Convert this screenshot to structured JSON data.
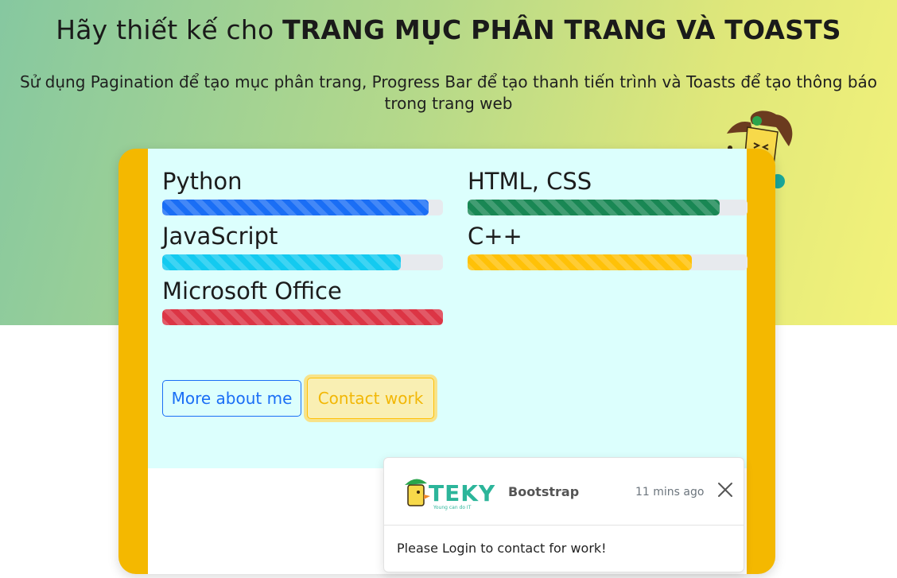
{
  "header": {
    "headline_prefix": "Hãy thiết kế cho ",
    "headline_bold": "TRANG MỤC PHÂN TRANG VÀ TOASTS",
    "subtitle": "Sử dụng Pagination để tạo mục phân trang, Progress Bar để tạo thanh tiến trình  và Toasts để tạo thông báo trong trang web"
  },
  "skills": [
    {
      "label": "Python",
      "progress": 0.95,
      "color": "#1a6ef5"
    },
    {
      "label": "HTML, CSS",
      "progress": 0.9,
      "color": "#198754"
    },
    {
      "label": "JavaScript",
      "progress": 0.85,
      "color": "#13caf0"
    },
    {
      "label": "C++",
      "progress": 0.8,
      "color": "#ffc107"
    },
    {
      "label": "Microsoft Office",
      "progress": 1.0,
      "color": "#dc3545"
    }
  ],
  "buttons": {
    "more_about_me": "More about me",
    "contact_work": "Contact work"
  },
  "toast": {
    "logo_text": "TEKY",
    "logo_tagline": "Young can do IT",
    "brand": "Bootstrap",
    "time": "11 mins ago",
    "close_icon": "close-icon",
    "message": "Please Login to contact for work!"
  },
  "colors": {
    "frame": "#f4b800",
    "panel": "#dcfffd",
    "primary": "#1a6ef5",
    "warning": "#ffc107",
    "teky_green": "#2cb59a"
  }
}
